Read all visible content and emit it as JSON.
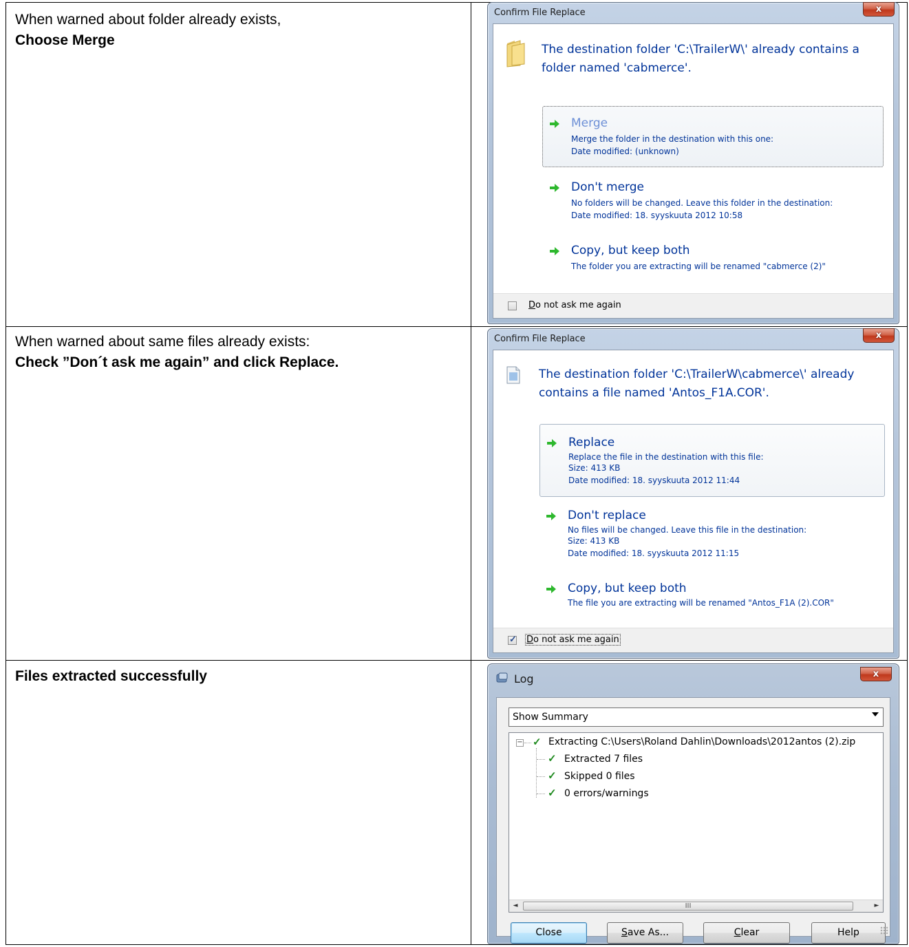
{
  "rows": [
    {
      "instruction_line1": "When warned about folder already exists,",
      "instruction_line2": "Choose Merge"
    },
    {
      "instruction_line1": "When warned about same files already exists:",
      "instruction_line2": "Check ”Don´t ask me again” and click Replace."
    },
    {
      "instruction_line1": "Files extracted successfully"
    }
  ],
  "dialog1": {
    "title": "Confirm File Replace",
    "close_label": "x",
    "message_line1": "The destination folder 'C:\\TrailerW\\' already contains a",
    "message_line2": "folder named 'cabmerce'.",
    "options": [
      {
        "title": "Merge",
        "lines": [
          "Merge the folder in the destination with this one:",
          "Date modified: (unknown)"
        ]
      },
      {
        "title": "Don't merge",
        "lines": [
          "No folders will be changed. Leave this folder in the destination:",
          "Date modified: 18. syyskuuta 2012 10:58"
        ]
      },
      {
        "title": "Copy, but keep both",
        "lines": [
          "The folder you are extracting will be renamed \"cabmerce (2)\""
        ]
      }
    ],
    "checkbox_label_key": "D",
    "checkbox_label_rest": "o not ask me again",
    "checkbox_checked": false
  },
  "dialog2": {
    "title": "Confirm File Replace",
    "close_label": "x",
    "message_line1": "The destination folder 'C:\\TrailerW\\cabmerce\\' already",
    "message_line2": "contains a file named 'Antos_F1A.COR'.",
    "options": [
      {
        "title": "Replace",
        "lines": [
          "Replace the file in the destination with this file:",
          "Size: 413 KB",
          "Date modified: 18. syyskuuta 2012 11:44"
        ]
      },
      {
        "title": "Don't replace",
        "lines": [
          "No files will be changed. Leave this file in the destination:",
          "Size: 413 KB",
          "Date modified: 18. syyskuuta 2012 11:15"
        ]
      },
      {
        "title": "Copy, but keep both",
        "lines": [
          "The file you are extracting will be renamed \"Antos_F1A (2).COR\""
        ]
      }
    ],
    "checkbox_label_key": "D",
    "checkbox_label_rest": "o not ask me again",
    "checkbox_checked": true
  },
  "dialog3": {
    "title": "Log",
    "close_label": "x",
    "select_value": "Show Summary",
    "tree": {
      "root": "Extracting C:\\Users\\Roland Dahlin\\Downloads\\2012antos (2).zip",
      "expander": "−",
      "children": [
        "Extracted 7 files",
        "Skipped 0 files",
        "0 errors/warnings"
      ]
    },
    "scroll_left": "◄",
    "scroll_right": "►",
    "scroll_thumb": "III",
    "buttons": {
      "close": "Close",
      "save_as_key": "S",
      "save_as_rest": "ave As...",
      "clear_key": "C",
      "clear_rest": "lear",
      "help": "Help"
    }
  },
  "colors": {
    "instruction_text": "#003399",
    "arrow_green": "#2eb82e",
    "check_green": "#1f8a1f"
  },
  "icons": {
    "option_arrow": "green-arrow-icon",
    "folder": "folder-icon",
    "file": "file-icon",
    "log": "log-app-icon",
    "tree_check": "check-icon"
  }
}
